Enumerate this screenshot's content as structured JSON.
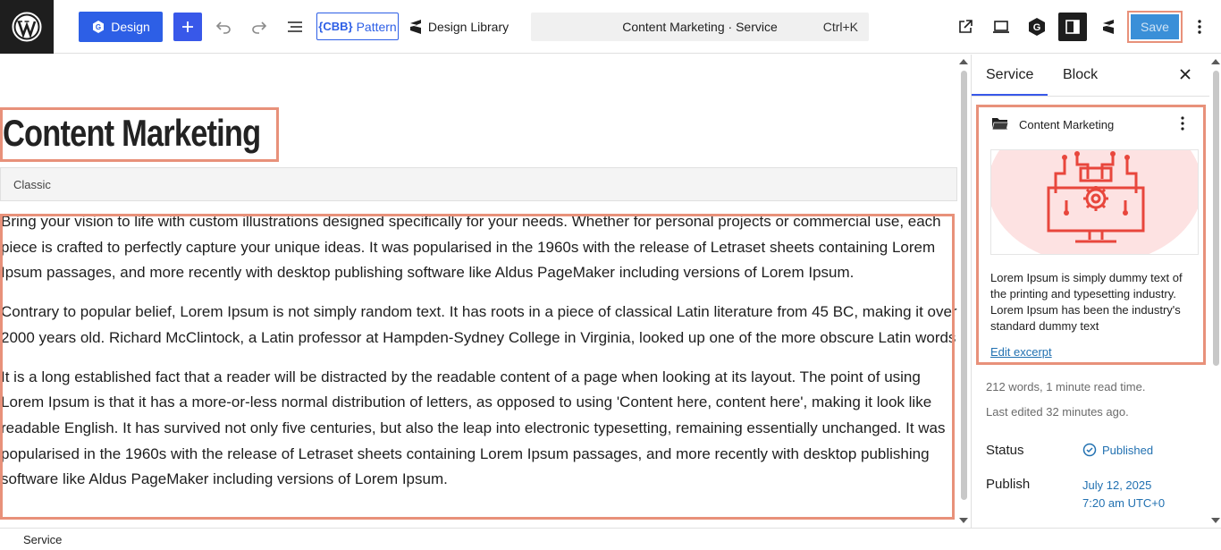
{
  "toolbar": {
    "design_label": "Design",
    "pattern_cbb": "{CBB}",
    "pattern_label": "Pattern",
    "library_label": "Design Library",
    "command_title": "Content Marketing · Service",
    "command_shortcut": "Ctrl+K",
    "save_label": "Save"
  },
  "editor": {
    "post_title": "Content Marketing",
    "classic_label": "Classic",
    "paragraphs": [
      "Bring your vision to life with custom illustrations designed specifically for your needs. Whether for personal projects or commercial use, each piece is crafted to perfectly capture your unique ideas. It was popularised in the 1960s with the release of Letraset sheets containing Lorem Ipsum passages, and more recently with desktop publishing software like Aldus PageMaker including versions of Lorem Ipsum.",
      "Contrary to popular belief, Lorem Ipsum is not simply random text. It has roots in a piece of classical Latin literature from 45 BC, making it over 2000 years old. Richard McClintock, a Latin professor at Hampden-Sydney College in Virginia, looked up one of the more obscure Latin words",
      "It is a long established fact that a reader will be distracted by the readable content of a page when looking at its layout. The point of using Lorem Ipsum is that it has a more-or-less normal distribution of letters, as opposed to using 'Content here, content here', making it look like readable English. It has survived not only five centuries, but also the leap into electronic typesetting, remaining essentially unchanged. It was popularised in the 1960s with the release of Letraset sheets containing Lorem Ipsum passages, and more recently with desktop publishing software like Aldus PageMaker including versions of Lorem Ipsum."
    ]
  },
  "statusbar": {
    "breadcrumb": "Service"
  },
  "sidebar": {
    "tab_service": "Service",
    "tab_block": "Block",
    "card_title": "Content Marketing",
    "excerpt": "Lorem Ipsum is simply dummy text of the printing and typesetting industry. Lorem Ipsum has been the industry's standard dummy text",
    "edit_excerpt": "Edit excerpt",
    "word_count": "212 words, 1 minute read time.",
    "last_edited": "Last edited 32 minutes ago.",
    "status_label": "Status",
    "status_value": "Published",
    "publish_label": "Publish",
    "publish_date": "July 12, 2025",
    "publish_time": "7:20 am UTC+0"
  },
  "colors": {
    "accent": "#3858e9",
    "design_button": "#2d5fe6",
    "highlight_border": "#e8917a",
    "image_red": "#e8463c",
    "image_bg": "#fde2e2"
  },
  "icons": [
    "wordpress-logo-icon",
    "plus-icon",
    "undo-icon",
    "redo-icon",
    "list-view-icon",
    "stackable-icon",
    "external-link-icon",
    "laptop-icon",
    "g-logo-icon",
    "sidebar-toggle-icon",
    "kebab-icon",
    "close-icon",
    "folder-icon",
    "check-circle-icon"
  ]
}
